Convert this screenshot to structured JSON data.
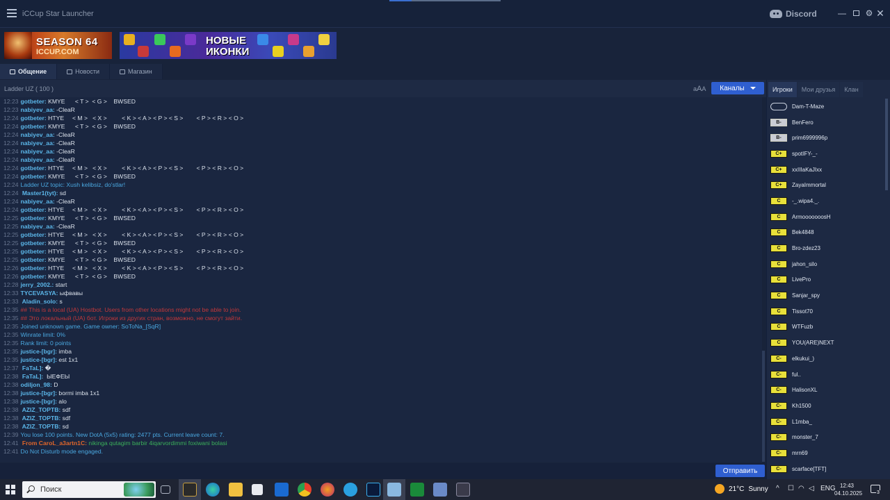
{
  "window": {
    "title": "iCCup Star Launcher",
    "discord_label": "Discord"
  },
  "banners": {
    "season": {
      "line1": "SEASON 64",
      "line2": "ICCUP.COM"
    },
    "icons": {
      "line1": "НОВЫЕ",
      "line2": "ИКОНКИ"
    }
  },
  "tabs": [
    {
      "label": "Общение",
      "icon": "chat-icon"
    },
    {
      "label": "Новости",
      "icon": "news-icon"
    },
    {
      "label": "Магазин",
      "icon": "cart-icon"
    }
  ],
  "chat": {
    "channel": "Ladder UZ  ( 100 )",
    "font_size_label": "aA",
    "channels_button": "Каналы",
    "input_value": "",
    "send_button": "Отправить",
    "lines": [
      {
        "ts": "12:23",
        "type": "nick",
        "nick": "gotbeter:",
        "text": " KMYE      < T >  < G >    BWSED"
      },
      {
        "ts": "12:23",
        "type": "nick",
        "nick": "nabiyev_aa:",
        "text": " -CleaR"
      },
      {
        "ts": "12:24",
        "type": "nick",
        "nick": "gotbeter:",
        "text": " HTYE     < M >   < X >         < K > < A > < P > < S >        < P > < R > < O >"
      },
      {
        "ts": "12:24",
        "type": "nick",
        "nick": "gotbeter:",
        "text": " KMYE      < T >  < G >    BWSED"
      },
      {
        "ts": "12:24",
        "type": "nick",
        "nick": "nabiyev_aa:",
        "text": " -CleaR"
      },
      {
        "ts": "12:24",
        "type": "nick",
        "nick": "nabiyev_aa:",
        "text": " -CleaR"
      },
      {
        "ts": "12:24",
        "type": "nick",
        "nick": "nabiyev_aa:",
        "text": " -CleaR"
      },
      {
        "ts": "12:24",
        "type": "nick",
        "nick": "nabiyev_aa:",
        "text": " -CleaR"
      },
      {
        "ts": "12:24",
        "type": "nick",
        "nick": "gotbeter:",
        "text": " HTYE     < M >   < X >         < K > < A > < P > < S >        < P > < R > < O >"
      },
      {
        "ts": "12:24",
        "type": "nick",
        "nick": "gotbeter:",
        "text": " KMYE      < T >  < G >    BWSED"
      },
      {
        "ts": "12:24",
        "type": "sys",
        "nick": "",
        "text": "Ladder UZ topic: Xush kelibsiz, do'stlar!"
      },
      {
        "ts": "12:24",
        "type": "nick",
        "nick": " Master1(tyt):",
        "text": " sd"
      },
      {
        "ts": "12:24",
        "type": "nick",
        "nick": "nabiyev_aa:",
        "text": " -CleaR"
      },
      {
        "ts": "12:24",
        "type": "nick",
        "nick": "gotbeter:",
        "text": " HTYE     < M >   < X >         < K > < A > < P > < S >        < P > < R > < O >"
      },
      {
        "ts": "12:25",
        "type": "nick",
        "nick": "gotbeter:",
        "text": " KMYE      < T >  < G >    BWSED"
      },
      {
        "ts": "12:25",
        "type": "nick",
        "nick": "nabiyev_aa:",
        "text": " -CleaR"
      },
      {
        "ts": "12:25",
        "type": "nick",
        "nick": "gotbeter:",
        "text": " HTYE     < M >   < X >         < K > < A > < P > < S >        < P > < R > < O >"
      },
      {
        "ts": "12:25",
        "type": "nick",
        "nick": "gotbeter:",
        "text": " KMYE      < T >  < G >    BWSED"
      },
      {
        "ts": "12:25",
        "type": "nick",
        "nick": "gotbeter:",
        "text": " HTYE     < M >   < X >         < K > < A > < P > < S >        < P > < R > < O >"
      },
      {
        "ts": "12:25",
        "type": "nick",
        "nick": "gotbeter:",
        "text": " KMYE      < T >  < G >    BWSED"
      },
      {
        "ts": "12:26",
        "type": "nick",
        "nick": "gotbeter:",
        "text": " HTYE     < M >   < X >         < K > < A > < P > < S >        < P > < R > < O >"
      },
      {
        "ts": "12:26",
        "type": "nick",
        "nick": "gotbeter:",
        "text": " KMYE      < T >  < G >    BWSED"
      },
      {
        "ts": "12:28",
        "type": "nick",
        "nick": "jerry_2002.:",
        "text": " start"
      },
      {
        "ts": "12:33",
        "type": "nick",
        "nick": "TYCEVASYA:",
        "text": " ыфвавы"
      },
      {
        "ts": "12:33",
        "type": "nick",
        "nick": " Aladin_solo:",
        "text": " s"
      },
      {
        "ts": "12:35",
        "type": "err",
        "nick": "",
        "text": "## This is a local (UA) Hostbot. Users from other locations might not be able to join."
      },
      {
        "ts": "12:35",
        "type": "err",
        "nick": "",
        "text": "## Это локальный (UA) бот. Игроки из других стран, возможно, не смогут зайти."
      },
      {
        "ts": "12:35",
        "type": "sys",
        "nick": "",
        "text": "Joined unknown game. Game owner: SoToNa_[SqR]"
      },
      {
        "ts": "12:35",
        "type": "sys",
        "nick": "",
        "text": "Winrate limit: 0%"
      },
      {
        "ts": "12:35",
        "type": "sys",
        "nick": "",
        "text": "Rank limit: 0 points"
      },
      {
        "ts": "12:35",
        "type": "nick",
        "nick": "justice-[bgr]:",
        "text": " imba"
      },
      {
        "ts": "12:35",
        "type": "nick",
        "nick": "justice-[bgr]:",
        "text": " est 1x1"
      },
      {
        "ts": "12:37",
        "type": "nick",
        "nick": " FaTaL]:",
        "text": " �"
      },
      {
        "ts": "12:38",
        "type": "nick",
        "nick": " FaTaL]:",
        "text": "  ЫЕФЕЫ"
      },
      {
        "ts": "12:38",
        "type": "nick",
        "nick": "odiljon_98:",
        "text": " D"
      },
      {
        "ts": "12:38",
        "type": "nick",
        "nick": "justice-[bgr]:",
        "text": " bormi imba 1x1"
      },
      {
        "ts": "12:38",
        "type": "nick",
        "nick": "justice-[bgr]:",
        "text": " alo"
      },
      {
        "ts": "12:38",
        "type": "nick",
        "nick": " AZIZ_TOPTB:",
        "text": " sdf"
      },
      {
        "ts": "12:38",
        "type": "nick",
        "nick": " AZIZ_TOPTB:",
        "text": " sdf"
      },
      {
        "ts": "12:38",
        "type": "nick",
        "nick": " AZIZ_TOPTB:",
        "text": " sd"
      },
      {
        "ts": "12:39",
        "type": "sys",
        "nick": "",
        "text": "You lose 100 points. New DotA (5x5) rating: 2477 pts. Current leave count: 7."
      },
      {
        "ts": "12:41",
        "type": "whisper",
        "nick": " From CaroL_a3artn1C:",
        "text": " nikinga qutagim barbir 4iqarvordimmi foxiwani bolasi"
      },
      {
        "ts": "12:41",
        "type": "sys",
        "nick": "",
        "text": "Do Not Disturb mode engaged."
      }
    ]
  },
  "right_panel": {
    "tabs": [
      "Игроки",
      "Мои друзья",
      "Клан"
    ],
    "players": [
      {
        "rank": "none",
        "badge": "",
        "name": "Dam-T-Maze"
      },
      {
        "rank": "bminus",
        "badge": "B-",
        "name": "BenFero"
      },
      {
        "rank": "bminus",
        "badge": "B-",
        "name": "prim6999996p"
      },
      {
        "rank": "cplus",
        "badge": "C+",
        "name": "spotIFY-_-"
      },
      {
        "rank": "cplus",
        "badge": "C+",
        "name": "xxIIIaKaJIxx"
      },
      {
        "rank": "cplus",
        "badge": "C+",
        "name": "ZayaImmortal"
      },
      {
        "rank": "c",
        "badge": "C",
        "name": "-_.wipa4._."
      },
      {
        "rank": "c",
        "badge": "C",
        "name": "ArmooooooosH"
      },
      {
        "rank": "c",
        "badge": "C",
        "name": "Bek4848"
      },
      {
        "rank": "c",
        "badge": "C",
        "name": "Bro-zdez23"
      },
      {
        "rank": "c",
        "badge": "C",
        "name": "jahon_silo"
      },
      {
        "rank": "c",
        "badge": "C",
        "name": "LivePro"
      },
      {
        "rank": "c",
        "badge": "C",
        "name": "Sanjar_spy"
      },
      {
        "rank": "c",
        "badge": "C",
        "name": "Tissot70"
      },
      {
        "rank": "c",
        "badge": "C",
        "name": "WTFuzb"
      },
      {
        "rank": "c",
        "badge": "C",
        "name": "YOU(ARE)NEXT"
      },
      {
        "rank": "cminus",
        "badge": "C-",
        "name": "elkukui_)"
      },
      {
        "rank": "cminus",
        "badge": "C-",
        "name": "ful.."
      },
      {
        "rank": "cminus",
        "badge": "C-",
        "name": "HalisonXL"
      },
      {
        "rank": "cminus",
        "badge": "C-",
        "name": "Kh1500"
      },
      {
        "rank": "cminus",
        "badge": "C-",
        "name": "L1mba_"
      },
      {
        "rank": "cminus",
        "badge": "C-",
        "name": "monster_7"
      },
      {
        "rank": "cminus",
        "badge": "C-",
        "name": "mrn69"
      },
      {
        "rank": "cminus",
        "badge": "C-",
        "name": "scarface[TFT]"
      }
    ]
  },
  "taskbar": {
    "search_placeholder": "Поиск",
    "weather": {
      "temp": "21°C",
      "condition": "Sunny"
    },
    "lang": "ENG",
    "time": "12:43",
    "date": "04.10.2025",
    "notifications": "3",
    "accent": "#2f5fd0"
  }
}
